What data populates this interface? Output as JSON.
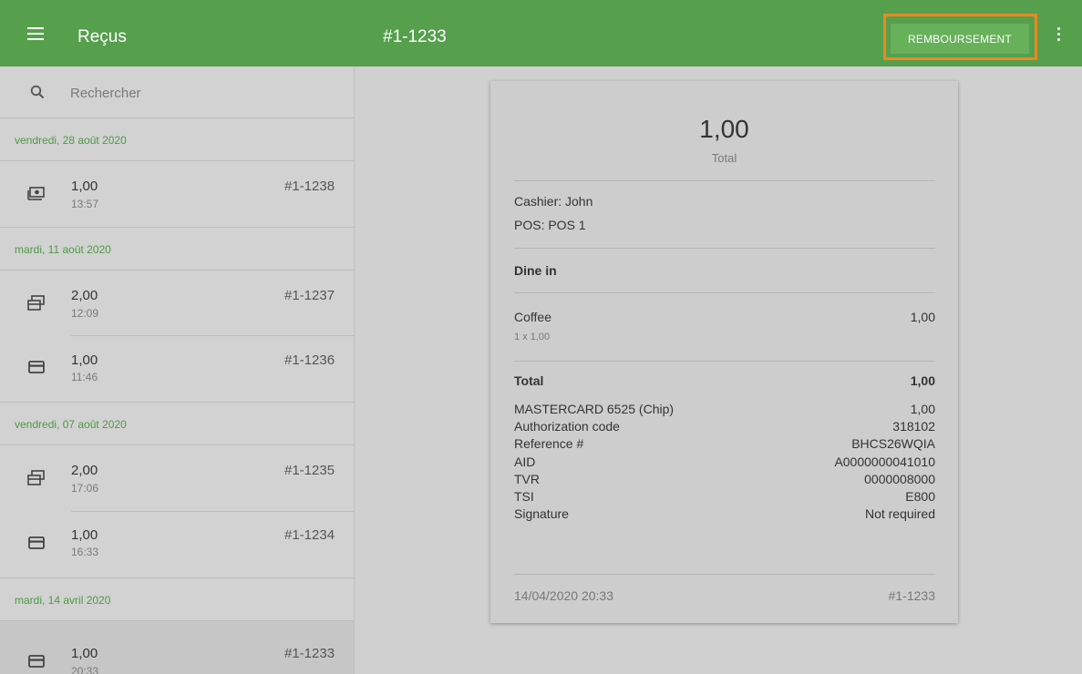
{
  "header": {
    "app_title": "Reçus",
    "receipt_title": "#1-1233",
    "refund_label": "REMBOURSEMENT"
  },
  "search": {
    "placeholder": "Rechercher"
  },
  "groups": [
    {
      "date": "vendredi, 28 août 2020",
      "items": [
        {
          "amount": "1,00",
          "time": "13:57",
          "id": "#1-1238",
          "icon": "cash-icon"
        }
      ]
    },
    {
      "date": "mardi, 11 août 2020",
      "items": [
        {
          "amount": "2,00",
          "time": "12:09",
          "id": "#1-1237",
          "icon": "split-payment-icon"
        },
        {
          "amount": "1,00",
          "time": "11:46",
          "id": "#1-1236",
          "icon": "card-icon"
        }
      ]
    },
    {
      "date": "vendredi, 07 août 2020",
      "items": [
        {
          "amount": "2,00",
          "time": "17:06",
          "id": "#1-1235",
          "icon": "split-payment-icon"
        },
        {
          "amount": "1,00",
          "time": "16:33",
          "id": "#1-1234",
          "icon": "card-icon"
        }
      ]
    },
    {
      "date": "mardi, 14 avril 2020",
      "items": [
        {
          "amount": "1,00",
          "time": "20:33",
          "id": "#1-1233",
          "icon": "card-icon",
          "selected": true
        }
      ]
    }
  ],
  "receipt": {
    "total_amount": "1,00",
    "total_label": "Total",
    "cashier": "Cashier: John",
    "pos": "POS: POS 1",
    "dining_option": "Dine in",
    "line_items": [
      {
        "name": "Coffee",
        "detail": "1 x 1,00",
        "price": "1,00"
      }
    ],
    "total_row": {
      "label": "Total",
      "value": "1,00"
    },
    "payment_details": [
      {
        "label": "MASTERCARD 6525 (Chip)",
        "value": "1,00"
      },
      {
        "label": "Authorization code",
        "value": "318102"
      },
      {
        "label": "Reference #",
        "value": "BHCS26WQIA"
      },
      {
        "label": "AID",
        "value": "A0000000041010"
      },
      {
        "label": "TVR",
        "value": "0000008000"
      },
      {
        "label": "TSI",
        "value": "E800"
      },
      {
        "label": "Signature",
        "value": "Not required"
      }
    ],
    "footer": {
      "datetime": "14/04/2020 20:33",
      "id": "#1-1233"
    }
  },
  "colors": {
    "header_green": "#569f4d",
    "date_green": "#4d9a43",
    "refund_highlight": "#f1861d"
  }
}
